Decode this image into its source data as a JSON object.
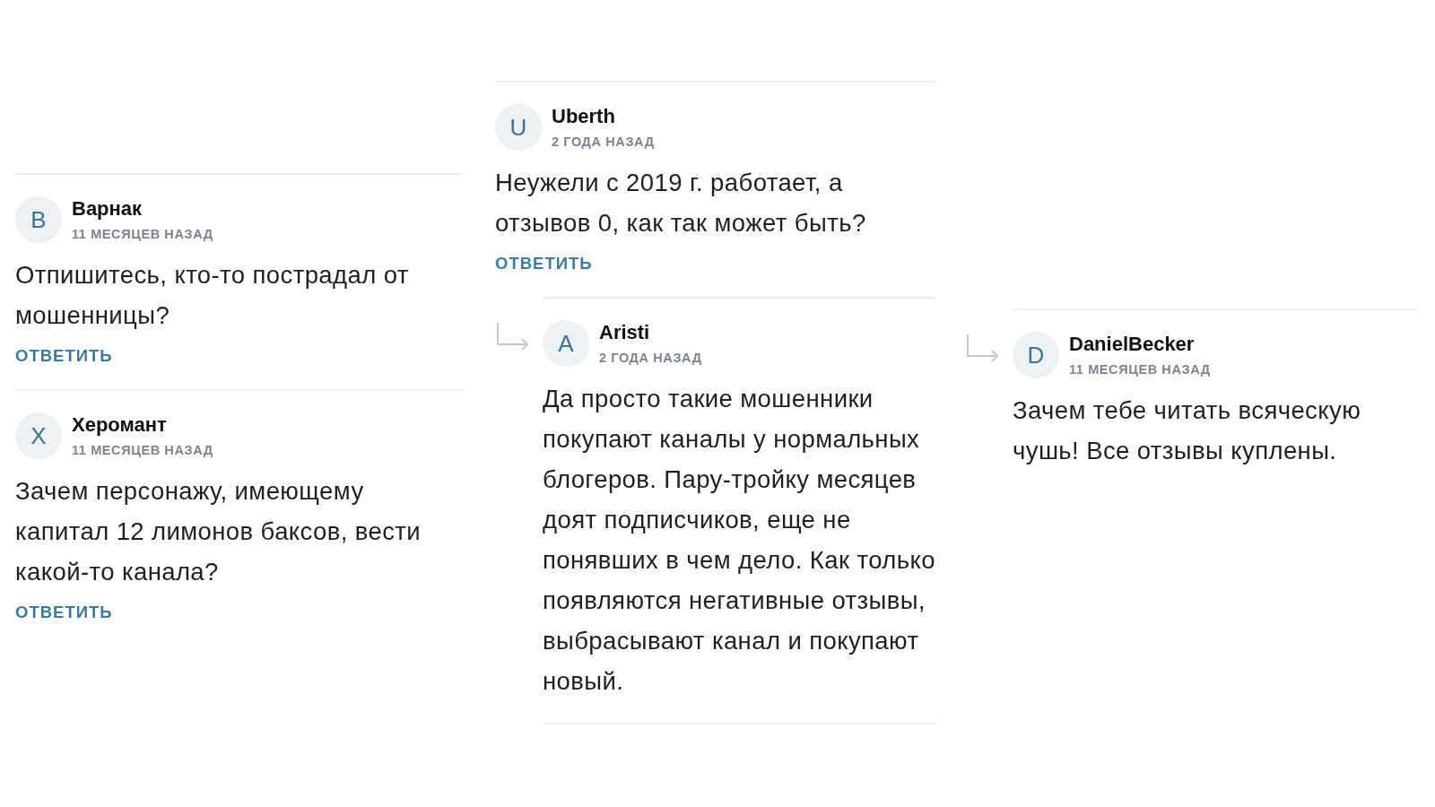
{
  "panels": [
    {
      "bottom_rule": false,
      "comments": [
        {
          "is_reply": false,
          "avatar": "В",
          "author": "Варнак",
          "time": "11 МЕСЯЦЕВ НАЗАД",
          "text": "Отпишитесь, кто-то пострадал от мошенницы?",
          "reply": "ОТВЕТИТЬ"
        },
        {
          "is_reply": false,
          "avatar": "Х",
          "author": "Херомант",
          "time": "11 МЕСЯЦЕВ НАЗАД",
          "text": "Зачем персонажу, имеющему капитал 12 лимонов баксов, вести какой-то канала?",
          "reply": "ОТВЕТИТЬ"
        }
      ]
    },
    {
      "bottom_rule": true,
      "comments": [
        {
          "is_reply": false,
          "avatar": "U",
          "author": "Uberth",
          "time": "2 ГОДА НАЗАД",
          "text": "Неужели с 2019 г. работает, а отзывов 0, как так может быть?",
          "reply": "ОТВЕТИТЬ"
        },
        {
          "is_reply": true,
          "avatar": "A",
          "author": "Aristi",
          "time": "2 ГОДА НАЗАД",
          "text": "Да просто такие мошенники покупают каналы у нормальных блогеров. Пару-тройку месяцев доят подписчиков, еще не понявших в чем дело. Как только появляются негативные отзывы, выбрасывают канал и покупают новый."
        }
      ]
    },
    {
      "bottom_rule": false,
      "comments": [
        {
          "is_reply": true,
          "avatar": "D",
          "author": "DanielBecker",
          "time": "11 МЕСЯЦЕВ НАЗАД",
          "text": "Зачем тебе читать всяческую чушь! Все отзывы куплены."
        }
      ]
    }
  ]
}
